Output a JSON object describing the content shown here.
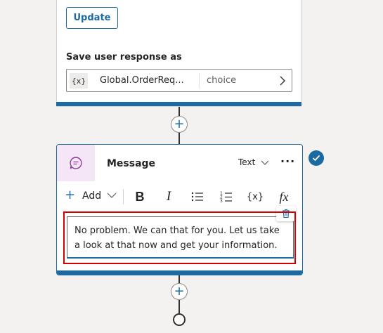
{
  "question_node": {
    "update_button": "Update",
    "save_label": "Save user response as",
    "variable": {
      "icon": "{x}",
      "name": "Global.OrderReq...",
      "type": "choice"
    }
  },
  "message_node": {
    "title": "Message",
    "type_label": "Text",
    "more": "···",
    "toolbar": {
      "add": "Add",
      "bold": "B",
      "italic": "I",
      "variable": "{x}",
      "formula": "fx"
    },
    "text": "No problem. We can that for you. Let us take a look at that now and get your information."
  },
  "colors": {
    "accent": "#1b6aa1",
    "highlight": "#d50000",
    "message_icon_bg": "#f4e6f6"
  }
}
